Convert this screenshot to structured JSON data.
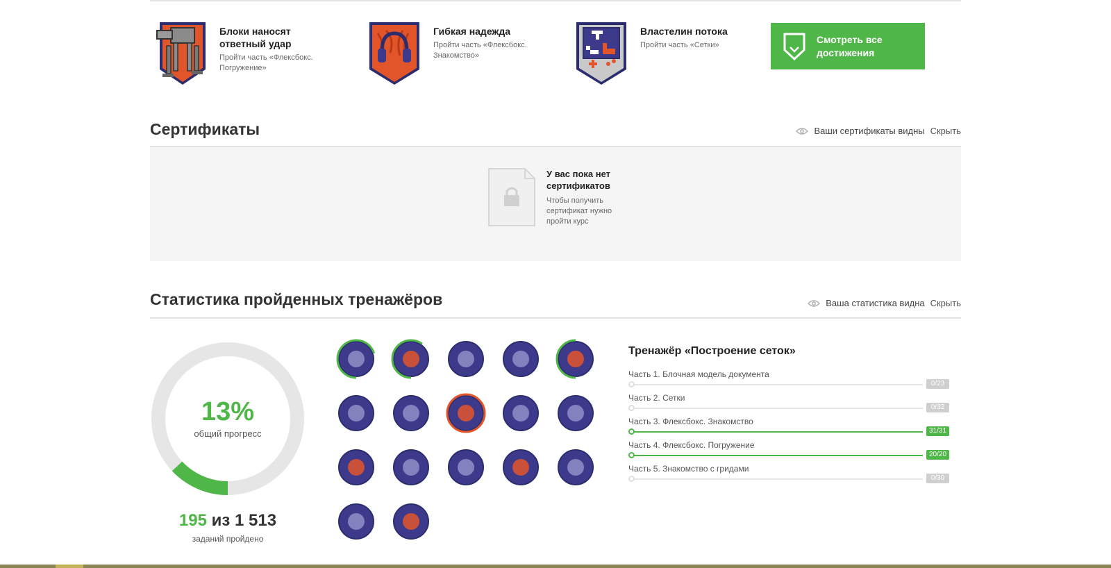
{
  "achievements": [
    {
      "title": "Блоки наносят ответный удар",
      "desc": "Пройти часть «Флексбокс. Погружение»",
      "icon": "walker-robot-badge"
    },
    {
      "title": "Гибкая надежда",
      "desc": "Пройти часть «Флексбокс. Знакомство»",
      "icon": "headphones-badge"
    },
    {
      "title": "Властелин потока",
      "desc": "Пройти часть «Сетки»",
      "icon": "game-console-badge"
    }
  ],
  "all_achievements_button": "Смотреть все достижения",
  "certificates": {
    "title": "Сертификаты",
    "visibility": "Ваши сертификаты видны",
    "hide": "Скрыть",
    "empty_title": "У вас пока нет сертификатов",
    "empty_desc": "Чтобы получить сертификат нужно пройти курс"
  },
  "stats": {
    "title": "Статистика пройденных тренажёров",
    "visibility": "Ваша статистика видна",
    "hide": "Скрыть",
    "percent": "13%",
    "percent_label": "общий прогресс",
    "progress_fraction": 0.13,
    "done": "195",
    "of": "из",
    "total": "1 513",
    "count_label": "заданий пройдено"
  },
  "trainer": {
    "title": "Тренажёр «Построение сеток»",
    "parts": [
      {
        "label": "Часть 1. Блочная модель документа",
        "progress": "0/23",
        "fraction": 0
      },
      {
        "label": "Часть 2. Сетки",
        "progress": "0/32",
        "fraction": 0
      },
      {
        "label": "Часть 3. Флексбокс. Знакомство",
        "progress": "31/31",
        "fraction": 1
      },
      {
        "label": "Часть 4. Флексбокс. Погружение",
        "progress": "20/20",
        "fraction": 1
      },
      {
        "label": "Часть 5. Знакомство с гридами",
        "progress": "0/30",
        "fraction": 0
      }
    ]
  },
  "trainer_badges": [
    {
      "icon": "traffic-light-icon",
      "progress": 0.7
    },
    {
      "icon": "hand-icon",
      "progress": 0.6
    },
    {
      "icon": "spinning-top-icon",
      "progress": 0
    },
    {
      "icon": "clapperboard-icon",
      "progress": 0
    },
    {
      "icon": "diving-helmet-icon",
      "progress": 0.5
    },
    {
      "icon": "curly-braces-icon",
      "progress": 0
    },
    {
      "icon": "fox-icon",
      "progress": 0
    },
    {
      "icon": "football-field-icon",
      "progress": 1
    },
    {
      "icon": "paint-brush-icon",
      "progress": 0
    },
    {
      "icon": "anvil-icon",
      "progress": 0
    },
    {
      "icon": "fox-cat-icon",
      "progress": 0
    },
    {
      "icon": "cursor-pie-icon",
      "progress": 0
    },
    {
      "icon": "rubik-cube-icon",
      "progress": 0
    },
    {
      "icon": "robot-remote-icon",
      "progress": 0
    },
    {
      "icon": "constellation-icon",
      "progress": 0
    },
    {
      "icon": "chainsaw-icon",
      "progress": 0
    },
    {
      "icon": "letter-t-icon",
      "progress": 0
    }
  ],
  "colors": {
    "accent": "#4fb648",
    "badge_bg": "#3d3a8c",
    "badge_orange": "#e2552a"
  }
}
